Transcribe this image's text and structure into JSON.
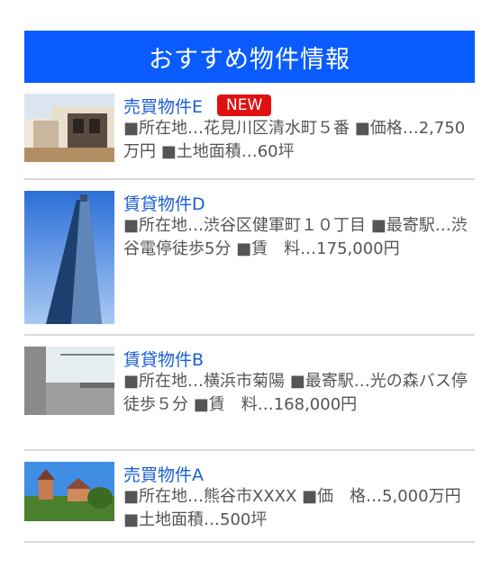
{
  "widget": {
    "header_title": "おすすめ物件情報"
  },
  "colors": {
    "header_bg": "#0a5cff",
    "title_link": "#1a5fd6",
    "badge_bg": "#e01010",
    "divider": "#d9d9d9",
    "body_text": "#555555"
  },
  "items": [
    {
      "title": "売買物件E",
      "badge": "NEW",
      "desc": "■所在地…花見川区清水町５番 ■価格…2,750万円 ■土地面積…60坪",
      "image": "building-photo"
    },
    {
      "title": "賃貸物件D",
      "desc": "■所在地…渋谷区健軍町１０丁目 ■最寄駅…渋谷電停徒歩5分 ■賃　料…175,000円",
      "image": "tower-photo"
    },
    {
      "title": "賃貸物件B",
      "desc": "■所在地…横浜市菊陽 ■最寄駅…光の森バス停徒歩５分 ■賃　料…168,000円",
      "image": "interior-photo"
    },
    {
      "title": "売買物件A",
      "desc": "■所在地…熊谷市XXXX ■価　格…5,000万円 ■土地面積…500坪",
      "image": "castle-photo"
    }
  ]
}
